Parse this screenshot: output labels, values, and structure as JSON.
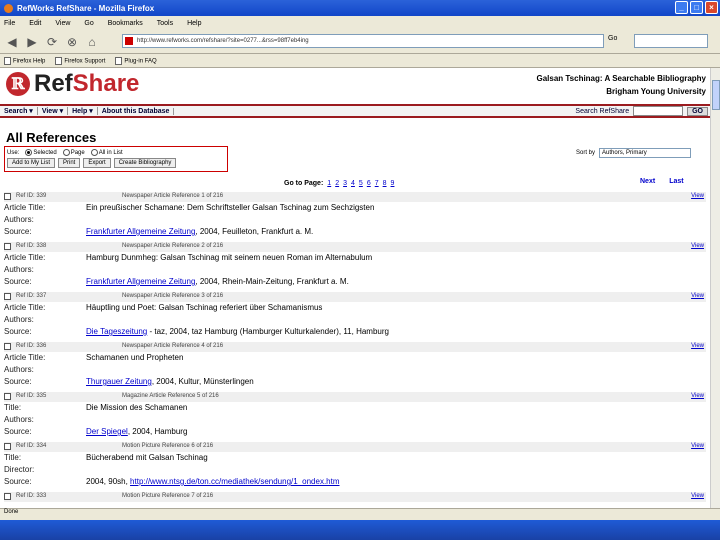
{
  "window": {
    "title": "RefWorks RefShare - Mozilla Firefox"
  },
  "menu": [
    "File",
    "Edit",
    "View",
    "Go",
    "Bookmarks",
    "Tools",
    "Help"
  ],
  "nav": {
    "url": "http://www.refworks.com/refshare/?site=0277...&rss=98ff7eb4ing",
    "go_label": "Go"
  },
  "bookmarks": [
    "Firefox Help",
    "Firefox Support",
    "Plug-in FAQ"
  ],
  "header": {
    "logo_ref": "Ref",
    "logo_share": "Share",
    "site_title": "Galsan Tschinag: A Searchable Bibliography",
    "site_org": "Brigham Young University"
  },
  "sitebar": {
    "items": [
      "Search ▾",
      "View ▾",
      "Help ▾",
      "About this Database"
    ],
    "search_label": "Search RefShare",
    "search_go": "GO"
  },
  "page_title": "All References",
  "controls": {
    "use_label": "Use:",
    "radios": [
      {
        "label": "Selected",
        "checked": true
      },
      {
        "label": "Page",
        "checked": false
      },
      {
        "label": "All in List",
        "checked": false
      }
    ],
    "buttons": [
      "Add to My List",
      "Print",
      "Export",
      "Create Bibliography"
    ]
  },
  "sort": {
    "label": "Sort by",
    "value": "Authors, Primary"
  },
  "pager": {
    "label": "Go to Page:",
    "pages": [
      "1",
      "2",
      "3",
      "4",
      "5",
      "6",
      "7",
      "8",
      "9"
    ],
    "next": "Next",
    "last": "Last"
  },
  "references": [
    {
      "id": "Ref ID: 339",
      "type": "Newspaper Article Reference 1 of 216",
      "view": "View",
      "rows": [
        {
          "label": "Article Title:",
          "value": "Ein preußischer Schamane: Dem Schriftsteller Galsan Tschinag zum Sechzigsten"
        },
        {
          "label": "Authors:",
          "value": ""
        },
        {
          "label": "Source:",
          "link": "Frankfurter Allgemeine Zeitung",
          "value": ", 2004, Feuilleton, Frankfurt a. M."
        }
      ]
    },
    {
      "id": "Ref ID: 338",
      "type": "Newspaper Article Reference 2 of 216",
      "view": "View",
      "rows": [
        {
          "label": "Article Title:",
          "value": "Hamburg Dunmheg: Galsan Tschinag mit seinem neuen Roman im Alternabulum"
        },
        {
          "label": "Authors:",
          "value": ""
        },
        {
          "label": "Source:",
          "link": "Frankfurter Allgemeine Zeitung",
          "value": ", 2004, Rhein-Main-Zeitung, Frankfurt a. M."
        }
      ]
    },
    {
      "id": "Ref ID: 337",
      "type": "Newspaper Article Reference 3 of 216",
      "view": "View",
      "rows": [
        {
          "label": "Article Title:",
          "value": "Häuptling und Poet: Galsan Tschinag referiert über Schamanismus"
        },
        {
          "label": "Authors:",
          "value": ""
        },
        {
          "label": "Source:",
          "link": "Die Tageszeitung",
          "value": " - taz, 2004, taz Hamburg (Hamburger Kulturkalender), 11, Hamburg"
        }
      ]
    },
    {
      "id": "Ref ID: 336",
      "type": "Newspaper Article Reference 4 of 216",
      "view": "View",
      "rows": [
        {
          "label": "Article Title:",
          "value": "Schamanen und Propheten"
        },
        {
          "label": "Authors:",
          "value": ""
        },
        {
          "label": "Source:",
          "link": "Thurgauer Zeitung",
          "value": ", 2004, Kultur, Münsterlingen"
        }
      ]
    },
    {
      "id": "Ref ID: 335",
      "type": "Magazine Article Reference 5 of 216",
      "view": "View",
      "rows": [
        {
          "label": "Title:",
          "value": "Die Mission des Schamanen"
        },
        {
          "label": "Authors:",
          "value": ""
        },
        {
          "label": "Source:",
          "link": "Der Spiegel",
          "value": ", 2004, Hamburg"
        }
      ]
    },
    {
      "id": "Ref ID: 334",
      "type": "Motion Picture Reference 6 of 216",
      "view": "View",
      "rows": [
        {
          "label": "Title:",
          "value": "Bücherabend mit Galsan Tschinag"
        },
        {
          "label": "Director:",
          "value": ""
        },
        {
          "label": "Source:",
          "value": "2004, 90sh, ",
          "link2": "http://www.ntsg.de/ton.cc/mediathek/sendung/1_ondex.htm"
        }
      ]
    },
    {
      "id": "Ref ID: 333",
      "type": "Motion Picture Reference 7 of 216",
      "view": "View",
      "rows": []
    }
  ],
  "status": "Done"
}
